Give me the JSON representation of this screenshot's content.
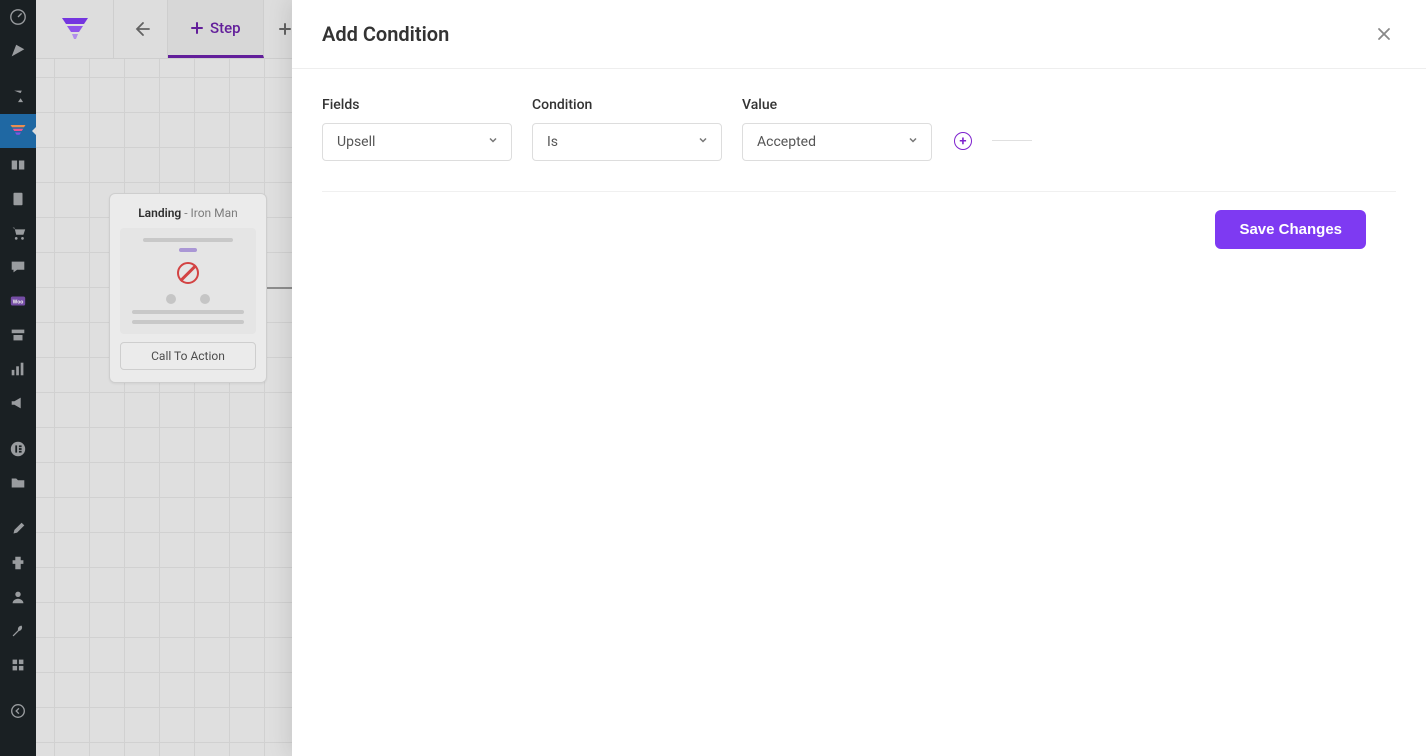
{
  "sidebar": {
    "items": [
      {
        "name": "dashboard-icon"
      },
      {
        "name": "flag-icon"
      },
      {
        "name": "pin-icon"
      },
      {
        "name": "funnel-icon",
        "active": true
      },
      {
        "name": "layers-icon"
      },
      {
        "name": "book-icon"
      },
      {
        "name": "cart-icon"
      },
      {
        "name": "comment-icon"
      },
      {
        "name": "woo-icon"
      },
      {
        "name": "storefront-icon"
      },
      {
        "name": "chart-icon"
      },
      {
        "name": "megaphone-icon"
      },
      {
        "name": "elementor-icon"
      },
      {
        "name": "folder-icon"
      },
      {
        "name": "paintbrush-icon"
      },
      {
        "name": "plugins-icon"
      },
      {
        "name": "user-icon"
      },
      {
        "name": "tools-icon"
      },
      {
        "name": "settings-icon"
      },
      {
        "name": "collapse-icon"
      }
    ]
  },
  "topbar": {
    "step_tab_label": "Step"
  },
  "node": {
    "title": "Landing",
    "subtitle": " - Iron Man",
    "cta_label": "Call To Action"
  },
  "modal": {
    "title": "Add Condition",
    "labels": {
      "fields": "Fields",
      "condition": "Condition",
      "value": "Value"
    },
    "values": {
      "fields": "Upsell",
      "condition": "Is",
      "value": "Accepted"
    },
    "save_label": "Save Changes"
  }
}
